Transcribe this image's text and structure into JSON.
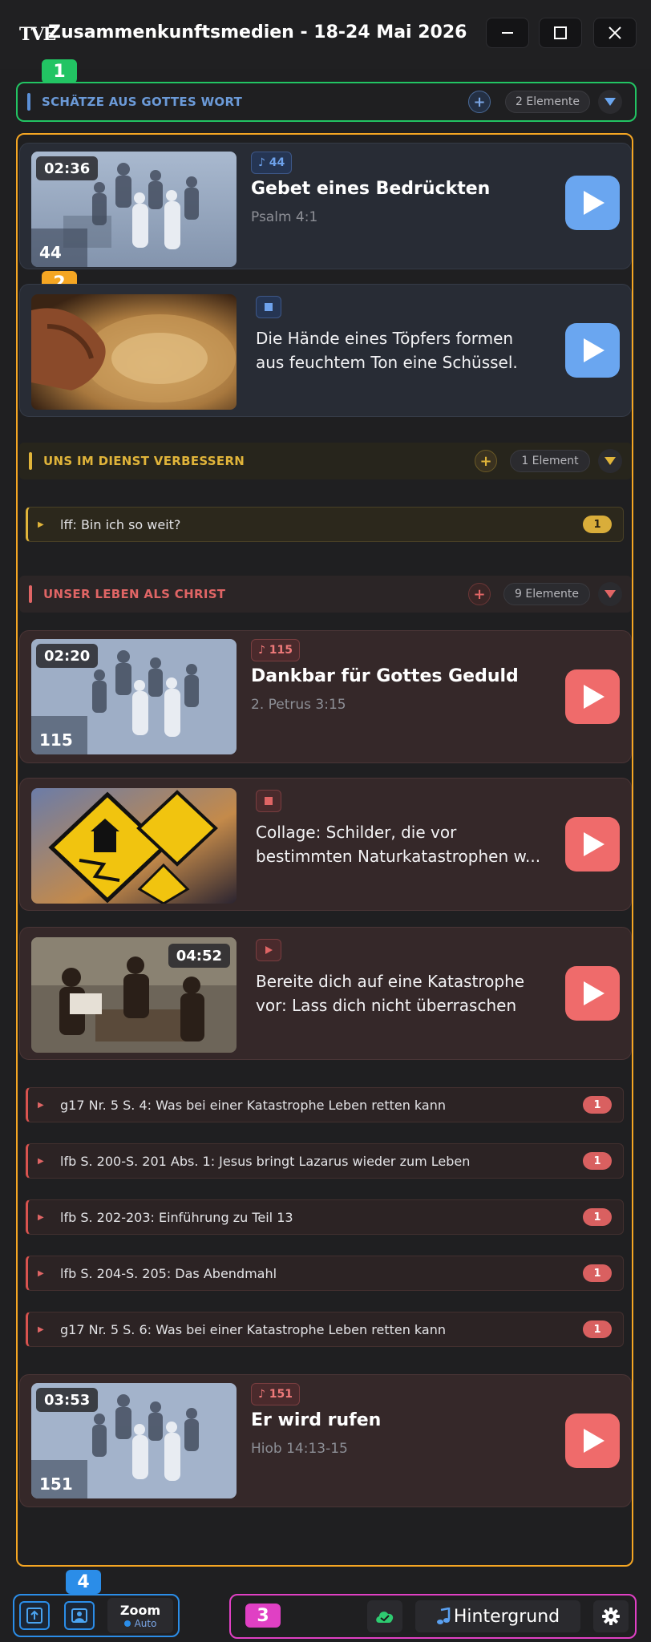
{
  "window": {
    "logo": "TVE",
    "title": "Zusammenkunftsmedien - 18-24 Mai 2026"
  },
  "tags": {
    "t1": "1",
    "t2": "2",
    "t3": "3",
    "t4": "4"
  },
  "sections": {
    "s1": {
      "title": "SCHÄTZE AUS GOTTES WORT",
      "count": "2 Elemente",
      "plus": "+",
      "color": "#5b8fd6"
    },
    "s2": {
      "title": "UNS IM DIENST VERBESSERN",
      "count": "1 Element",
      "plus": "+",
      "color": "#e0b43a"
    },
    "s3": {
      "title": "UNSER LEBEN ALS CHRIST",
      "count": "9 Elemente",
      "plus": "+",
      "color": "#e06565"
    }
  },
  "items": {
    "song44": {
      "duration": "02:36",
      "number": "44",
      "badge": "♪ 44",
      "title": "Gebet eines Bedrückten",
      "subtitle": "Psalm 4:1"
    },
    "img1": {
      "description": "Die Hände eines Töpfers formen aus feuchtem Ton eine Schüssel."
    },
    "lff": {
      "label": "lff: Bin ich so weit?",
      "count": "1"
    },
    "song115": {
      "duration": "02:20",
      "number": "115",
      "badge": "♪ 115",
      "title": "Dankbar für Gottes Geduld",
      "subtitle": "2. Petrus 3:15"
    },
    "img2": {
      "description": "Collage: Schilder, die vor bestimmten Naturkatastrophen w..."
    },
    "video1": {
      "duration": "04:52",
      "description": "Bereite dich auf eine Katastrophe vor: Lass dich nicht überraschen"
    },
    "refs": [
      {
        "label": "g17 Nr. 5 S. 4: Was bei einer Katastrophe Leben retten kann",
        "count": "1"
      },
      {
        "label": "lfb S. 200-S. 201 Abs. 1: Jesus bringt Lazarus wieder zum Leben",
        "count": "1"
      },
      {
        "label": "lfb S. 202-203: Einführung zu Teil 13",
        "count": "1"
      },
      {
        "label": "lfb S. 204-S. 205: Das Abendmahl",
        "count": "1"
      },
      {
        "label": "g17 Nr. 5 S. 6: Was bei einer Katastrophe Leben retten kann",
        "count": "1"
      }
    ],
    "song151": {
      "duration": "03:53",
      "number": "151",
      "badge": "♪ 151",
      "title": "Er wird rufen",
      "subtitle": "Hiob 14:13-15"
    }
  },
  "toolbar": {
    "zoom_label": "Zoom",
    "zoom_mode": "Auto",
    "background_label": "Hintergrund"
  },
  "colors": {
    "accent_blue": "#6aa6f0",
    "accent_red": "#ef6b6b",
    "accent_gold": "#e0b43a"
  }
}
